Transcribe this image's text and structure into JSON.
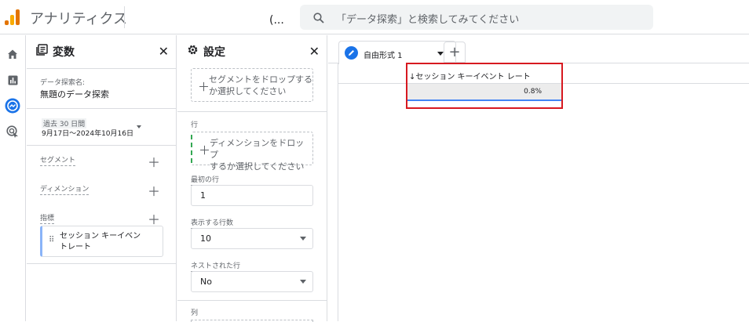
{
  "app": {
    "title": "アナリティクス",
    "ellipsis": "(..."
  },
  "search": {
    "placeholder": "「データ探索」と検索してみてください"
  },
  "rail": {
    "items": [
      "home-icon",
      "reports-icon",
      "explore-icon",
      "advertising-icon"
    ]
  },
  "variables": {
    "title": "変数",
    "exploration_name_label": "データ探索名:",
    "exploration_name": "無題のデータ探索",
    "date_range_label": "過去 30 日間",
    "date_range": "9月17日～2024年10月16日",
    "segments_label": "セグメント",
    "dimensions_label": "ディメンション",
    "metrics_label": "指標",
    "metric_chip_line1": "セッション キーイベン",
    "metric_chip_line2": "トレート"
  },
  "settings": {
    "title": "設定",
    "segment_drop_line1": "セグメントをドロップする",
    "segment_drop_line2": "か選択してください",
    "rows_label": "行",
    "dimension_drop_line1": "ディメンションをドロップ",
    "dimension_drop_line2": "するか選択してください",
    "start_row_label": "最初の行",
    "start_row_value": "1",
    "show_rows_label": "表示する行数",
    "show_rows_value": "10",
    "nested_rows_label": "ネストされた行",
    "nested_rows_value": "No",
    "columns_label": "列"
  },
  "canvas": {
    "tab_label": "自由形式 1",
    "column_header": "↓セッション キーイベント レート",
    "total_value": "0.8%"
  },
  "colors": {
    "accent": "#1a73e8",
    "highlight_box": "#d71920",
    "logo_orange": "#e37400",
    "logo_yellow": "#f9ab00"
  }
}
